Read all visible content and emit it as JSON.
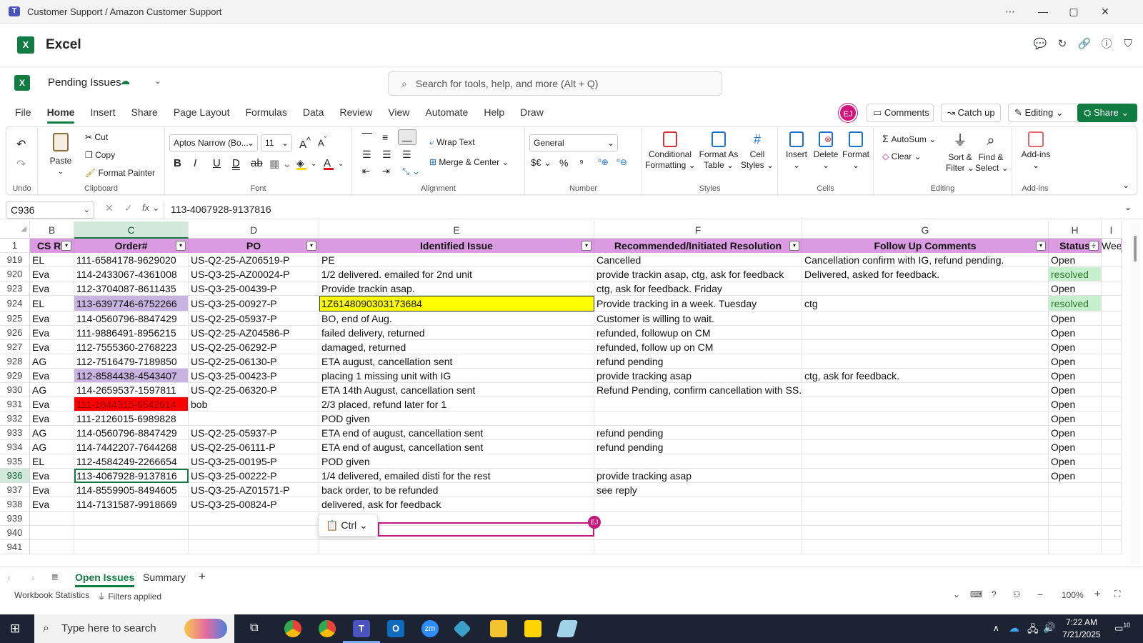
{
  "window": {
    "title": "Customer Support / Amazon Customer Support"
  },
  "app": {
    "name": "Excel",
    "logo_letter": "X"
  },
  "doc": {
    "name": "Pending Issues",
    "search_placeholder": "Search for tools, help, and more (Alt + Q)"
  },
  "tabs": [
    "File",
    "Home",
    "Insert",
    "Share",
    "Page Layout",
    "Formulas",
    "Data",
    "Review",
    "View",
    "Automate",
    "Help",
    "Draw"
  ],
  "active_tab": "Home",
  "top_buttons": {
    "avatar": "EJ",
    "comments": "Comments",
    "catch_up": "Catch up",
    "editing": "Editing",
    "share": "Share"
  },
  "ribbon": {
    "undo_group": "Undo",
    "clipboard": {
      "paste": "Paste",
      "cut": "Cut",
      "copy": "Copy",
      "format_painter": "Format Painter",
      "label": "Clipboard"
    },
    "font": {
      "name": "Aptos Narrow (Bo...",
      "size": "11",
      "label": "Font"
    },
    "alignment": {
      "wrap": "Wrap Text",
      "merge": "Merge & Center",
      "label": "Alignment"
    },
    "number": {
      "format": "General",
      "label": "Number"
    },
    "styles": {
      "cond": "Conditional",
      "cond2": "Formatting",
      "fat": "Format As",
      "fat2": "Table",
      "cell": "Cell",
      "cell2": "Styles",
      "label": "Styles"
    },
    "cells": {
      "insert": "Insert",
      "delete": "Delete",
      "format": "Format",
      "label": "Cells"
    },
    "editing": {
      "autosum": "AutoSum",
      "clear": "Clear",
      "sort": "Sort &",
      "sort2": "Filter",
      "find": "Find &",
      "find2": "Select",
      "label": "Editing"
    },
    "addins": {
      "label_btn": "Add-ins",
      "label": "Add-ins"
    }
  },
  "formula_bar": {
    "name_box": "C936",
    "formula": "113-4067928-9137816"
  },
  "columns": [
    "B",
    "C",
    "D",
    "E",
    "F",
    "G",
    "H",
    "I"
  ],
  "header_row": {
    "row": "1",
    "cells": [
      "CS Re",
      "Order#",
      "PO",
      "Identified Issue",
      "Recommended/Initiated Resolution",
      "Follow Up Comments",
      "Status",
      "Weel"
    ]
  },
  "rows": [
    {
      "row": "919",
      "b": "EL",
      "c": "111-6584178-9629020",
      "d": "US-Q2-25-AZ06519-P",
      "e": "PE",
      "f": "Cancelled",
      "g": "Cancellation confirm with IG, refund pending.",
      "h": "Open"
    },
    {
      "row": "920",
      "b": "Eva",
      "c": "114-2433067-4361008",
      "d": "US-Q3-25-AZ00024-P",
      "e": "1/2 delivered. emailed for 2nd unit",
      "f": "provide trackin asap, ctg, ask for feedback",
      "g": "Delivered, asked for feedback.",
      "h": "resolved"
    },
    {
      "row": "923",
      "b": "Eva",
      "c": "112-3704087-8611435",
      "d": "US-Q3-25-00439-P",
      "e": "Provide trackin asap.",
      "f": "ctg, ask for feedback. Friday",
      "g": "",
      "h": "Open"
    },
    {
      "row": "924",
      "b": "EL",
      "c": "113-6397746-6752266",
      "d": "US-Q3-25-00927-P",
      "e": "1Z6148090303173684",
      "f": "Provide tracking in a week. Tuesday",
      "g": "ctg",
      "h": "resolved"
    },
    {
      "row": "925",
      "b": "Eva",
      "c": "114-0560796-8847429",
      "d": "US-Q2-25-05937-P",
      "e": "BO, end of Aug.",
      "f": "Customer is willing to wait.",
      "g": "",
      "h": "Open"
    },
    {
      "row": "926",
      "b": "Eva",
      "c": "111-9886491-8956215",
      "d": "US-Q2-25-AZ04586-P",
      "e": "failed delivery, returned",
      "f": "refunded, followup on CM",
      "g": "",
      "h": "Open"
    },
    {
      "row": "927",
      "b": "Eva",
      "c": "112-7555360-2768223",
      "d": "US-Q2-25-06292-P",
      "e": "damaged, returned",
      "f": "refunded, follow up on CM",
      "g": "",
      "h": "Open"
    },
    {
      "row": "928",
      "b": "AG",
      "c": "112-7516479-7189850",
      "d": "US-Q2-25-06130-P",
      "e": "ETA august, cancellation sent",
      "f": "refund pending",
      "g": "",
      "h": "Open"
    },
    {
      "row": "929",
      "b": "Eva",
      "c": "112-8584438-4543407",
      "d": "US-Q3-25-00423-P",
      "e": "placing 1 missing unit with IG",
      "f": "provide tracking asap",
      "g": "ctg, ask for feedback.",
      "h": "Open"
    },
    {
      "row": "930",
      "b": "AG",
      "c": "114-2659537-1597811",
      "d": "US-Q2-25-06320-P",
      "e": "ETA 14th August, cancellation sent",
      "f": "Refund Pending, confirm cancellation with SS.",
      "g": "",
      "h": "Open"
    },
    {
      "row": "931",
      "b": "Eva",
      "c": "111-1844315-6542614",
      "d": "bob",
      "e": "2/3 placed, refund later for 1",
      "f": "",
      "g": "",
      "h": "Open"
    },
    {
      "row": "932",
      "b": "Eva",
      "c": "111-2126015-6989828",
      "d": "",
      "e": "POD given",
      "f": "",
      "g": "",
      "h": "Open"
    },
    {
      "row": "933",
      "b": "AG",
      "c": "114-0560796-8847429",
      "d": "US-Q2-25-05937-P",
      "e": "ETA end of august, cancellation sent",
      "f": "refund pending",
      "g": "",
      "h": "Open"
    },
    {
      "row": "934",
      "b": "AG",
      "c": "114-7442207-7644268",
      "d": "US-Q2-25-06111-P",
      "e": "ETA end of august, cancellation sent",
      "f": "refund pending",
      "g": "",
      "h": "Open"
    },
    {
      "row": "935",
      "b": "EL",
      "c": "112-4584249-2266654",
      "d": "US-Q3-25-00195-P",
      "e": "POD given",
      "f": "",
      "g": "",
      "h": "Open"
    },
    {
      "row": "936",
      "b": "Eva",
      "c": "113-4067928-9137816",
      "d": "US-Q3-25-00222-P",
      "e": "1/4 delivered, emailed disti for the rest",
      "f": "provide tracking asap",
      "g": "",
      "h": "Open"
    },
    {
      "row": "937",
      "b": "Eva",
      "c": "114-8559905-8494605",
      "d": "US-Q3-25-AZ01571-P",
      "e": "back order, to be refunded",
      "f": "see reply",
      "g": "",
      "h": ""
    },
    {
      "row": "938",
      "b": "Eva",
      "c": "114-7131587-9918669",
      "d": "US-Q3-25-00824-P",
      "e": "delivered, ask for feedback",
      "f": "",
      "g": "",
      "h": ""
    },
    {
      "row": "939",
      "b": "",
      "c": "",
      "d": "",
      "e": "",
      "f": "",
      "g": "",
      "h": ""
    },
    {
      "row": "940",
      "b": "",
      "c": "",
      "d": "",
      "e": "",
      "f": "",
      "g": "",
      "h": ""
    },
    {
      "row": "941",
      "b": "",
      "c": "",
      "d": "",
      "e": "",
      "f": "",
      "g": "",
      "h": ""
    }
  ],
  "paste_popup": {
    "label": "Ctrl"
  },
  "collab_badge": "EJ",
  "sheets": [
    "Open Issues",
    "Summary"
  ],
  "active_sheet": "Open Issues",
  "status": {
    "stats": "Workbook Statistics",
    "filters": "Filters applied",
    "zoom": "100%"
  },
  "taskbar": {
    "search": "Type here to search",
    "time": "7:22 AM",
    "date": "7/21/2025",
    "notif": "10"
  },
  "colors": {
    "header_fill": "#da9be2",
    "resolved_fill": "#c6efce",
    "resolved_text": "#2e7d32",
    "purple_fill": "#c9b3e0",
    "red_fill": "#ff0000",
    "yellow_fill": "#ffff00",
    "accent": "#107c41"
  }
}
